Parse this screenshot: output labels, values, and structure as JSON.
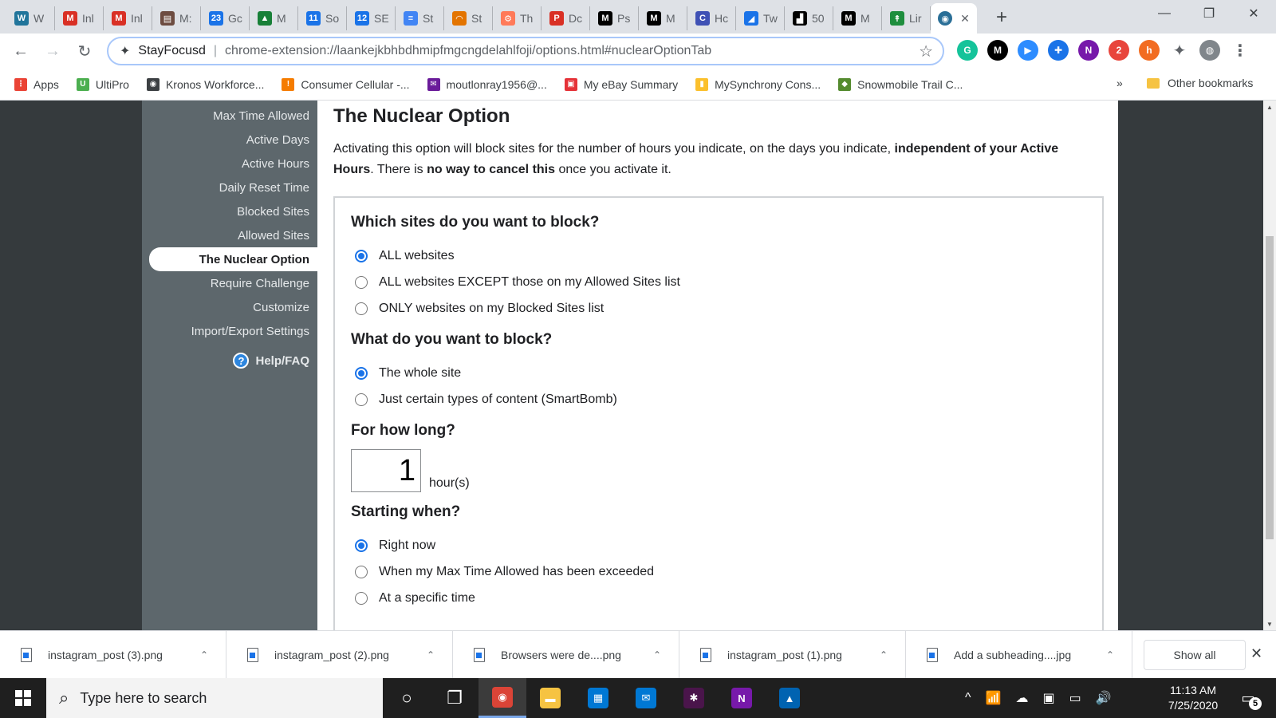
{
  "browser": {
    "tabs": [
      {
        "label": "W",
        "color": "#21759b",
        "glyph": "W"
      },
      {
        "label": "Inl",
        "color": "#d93025",
        "glyph": "M"
      },
      {
        "label": "Inl",
        "color": "#d93025",
        "glyph": "M"
      },
      {
        "label": "M:",
        "color": "#6d4c41",
        "glyph": "▤"
      },
      {
        "label": "Gc",
        "color": "#1a73e8",
        "glyph": "23"
      },
      {
        "label": "M",
        "color": "#188038",
        "glyph": "▲"
      },
      {
        "label": "So",
        "color": "#1a73e8",
        "glyph": "11"
      },
      {
        "label": "SE",
        "color": "#1a73e8",
        "glyph": "12"
      },
      {
        "label": "St",
        "color": "#4285f4",
        "glyph": "≡"
      },
      {
        "label": "St",
        "color": "#e37400",
        "glyph": "◠"
      },
      {
        "label": "Th",
        "color": "#ff7a59",
        "glyph": "⚙"
      },
      {
        "label": "Dc",
        "color": "#d93025",
        "glyph": "P"
      },
      {
        "label": "Ps",
        "color": "#000000",
        "glyph": "M"
      },
      {
        "label": "M",
        "color": "#000000",
        "glyph": "M"
      },
      {
        "label": "Hc",
        "color": "#3f51b5",
        "glyph": "C"
      },
      {
        "label": "Tw",
        "color": "#1a73e8",
        "glyph": "◢"
      },
      {
        "label": "50",
        "color": "#000000",
        "glyph": "▟"
      },
      {
        "label": "M",
        "color": "#000000",
        "glyph": "M"
      },
      {
        "label": "Lir",
        "color": "#1e8e3e",
        "glyph": "↟"
      }
    ],
    "active_tab_close": "✕",
    "new_tab": "+",
    "window_controls": {
      "minimize": "—",
      "restore": "❐",
      "close": "✕"
    },
    "nav": {
      "back": "←",
      "forward": "→",
      "reload": "↻"
    },
    "omnibox": {
      "site_name": "StayFocusd",
      "separator": "|",
      "url": "chrome-extension://laankejkbhbdhmipfmgcngdelahlfoji/options.html#nuclearOptionTab",
      "star": "☆"
    },
    "extensions": [
      {
        "icon": "grammarly-icon",
        "glyph": "G",
        "color": "#15c39a"
      },
      {
        "icon": "medium-icon",
        "glyph": "M",
        "color": "#000000"
      },
      {
        "icon": "zoom-icon",
        "glyph": "▶",
        "color": "#2d8cff"
      },
      {
        "icon": "plus-extension-icon",
        "glyph": "✚",
        "color": "#1a73e8"
      },
      {
        "icon": "onenote-icon",
        "glyph": "N",
        "color": "#7719aa"
      },
      {
        "icon": "badge-extension-icon",
        "glyph": "2",
        "color": "#e8453c"
      },
      {
        "icon": "honey-icon",
        "glyph": "h",
        "color": "#f26c21"
      },
      {
        "icon": "puzzle-icon",
        "glyph": "✦",
        "color": "#5f6368"
      },
      {
        "icon": "profile-avatar-icon",
        "glyph": "◍",
        "color": "#80868b"
      },
      {
        "icon": "menu-dots-icon",
        "glyph": "⋮",
        "color": "#5f6368"
      }
    ],
    "bookmarks": [
      {
        "label": "Apps",
        "color": "#ea4335",
        "glyph": "⋮"
      },
      {
        "label": "UltiPro",
        "color": "#4caf50",
        "glyph": "U"
      },
      {
        "label": "Kronos Workforce...",
        "color": "#3c4043",
        "glyph": "◉"
      },
      {
        "label": "Consumer Cellular -...",
        "color": "#f57c00",
        "glyph": "!"
      },
      {
        "label": "moutlonray1956@...",
        "color": "#6a1b9a",
        "glyph": "✉"
      },
      {
        "label": "My eBay Summary",
        "color": "#e53238",
        "glyph": "▣"
      },
      {
        "label": "MySynchrony Cons...",
        "color": "#fbc02d",
        "glyph": "▮"
      },
      {
        "label": "Snowmobile Trail C...",
        "color": "#558b2f",
        "glyph": "◆"
      }
    ],
    "bookmarks_more": "»",
    "other_bookmarks": "Other bookmarks"
  },
  "sidebar": {
    "items": [
      {
        "label": "Max Time Allowed",
        "active": false
      },
      {
        "label": "Active Days",
        "active": false
      },
      {
        "label": "Active Hours",
        "active": false
      },
      {
        "label": "Daily Reset Time",
        "active": false
      },
      {
        "label": "Blocked Sites",
        "active": false
      },
      {
        "label": "Allowed Sites",
        "active": false
      },
      {
        "label": "The Nuclear Option",
        "active": true
      },
      {
        "label": "Require Challenge",
        "active": false
      },
      {
        "label": "Customize",
        "active": false
      },
      {
        "label": "Import/Export Settings",
        "active": false
      }
    ],
    "help": {
      "glyph": "?",
      "label": "Help/FAQ"
    }
  },
  "main": {
    "title": "The Nuclear Option",
    "intro": {
      "part1": "Activating this option will block sites for the number of hours you indicate, on the days you indicate, ",
      "bold1": "independent of your Active Hours",
      "part2": ". There is ",
      "bold2": "no way to cancel this",
      "part3": " once you activate it."
    },
    "q_sites": {
      "heading": "Which sites do you want to block?",
      "options": [
        {
          "label": "ALL websites",
          "checked": true
        },
        {
          "label": "ALL websites EXCEPT those on my Allowed Sites list",
          "checked": false
        },
        {
          "label": "ONLY websites on my Blocked Sites list",
          "checked": false
        }
      ]
    },
    "q_what": {
      "heading": "What do you want to block?",
      "options": [
        {
          "label": "The whole site",
          "checked": true
        },
        {
          "label": "Just certain types of content (SmartBomb)",
          "checked": false
        }
      ]
    },
    "q_duration": {
      "heading": "For how long?",
      "value": "1",
      "unit": "hour(s)"
    },
    "q_start": {
      "heading": "Starting when?",
      "options": [
        {
          "label": "Right now",
          "checked": true
        },
        {
          "label": "When my Max Time Allowed has been exceeded",
          "checked": false
        },
        {
          "label": "At a specific time",
          "checked": false
        }
      ]
    }
  },
  "downloads": {
    "items": [
      {
        "name": "instagram_post (3).png"
      },
      {
        "name": "instagram_post (2).png"
      },
      {
        "name": "Browsers were de....png"
      },
      {
        "name": "instagram_post (1).png"
      },
      {
        "name": "Add a subheading....jpg"
      }
    ],
    "chevron": "⌃",
    "show_all": "Show all",
    "close": "✕"
  },
  "taskbar": {
    "search_placeholder": "Type here to search",
    "search_glyph": "⌕",
    "apps": [
      {
        "name": "cortana-icon",
        "glyph": "○",
        "color": "transparent",
        "active": false
      },
      {
        "name": "task-view-icon",
        "glyph": "❐",
        "color": "transparent",
        "active": false
      },
      {
        "name": "chrome-icon",
        "glyph": "◉",
        "color": "#db4437",
        "active": true
      },
      {
        "name": "file-explorer-icon",
        "glyph": "▬",
        "color": "#f6c342",
        "active": false
      },
      {
        "name": "store-icon",
        "glyph": "▦",
        "color": "#0078d4",
        "active": false
      },
      {
        "name": "mail-icon",
        "glyph": "✉",
        "color": "#0078d4",
        "active": false
      },
      {
        "name": "slack-icon",
        "glyph": "✱",
        "color": "#4a154b",
        "active": false
      },
      {
        "name": "onenote-icon",
        "glyph": "N",
        "color": "#7719aa",
        "active": false
      },
      {
        "name": "photos-icon",
        "glyph": "▲",
        "color": "#0063b1",
        "active": false
      }
    ],
    "tray": [
      "^",
      "📶",
      "☁",
      "▣",
      "▭",
      "🔊"
    ],
    "time": "11:13 AM",
    "date": "7/25/2020",
    "notifications": "5"
  }
}
